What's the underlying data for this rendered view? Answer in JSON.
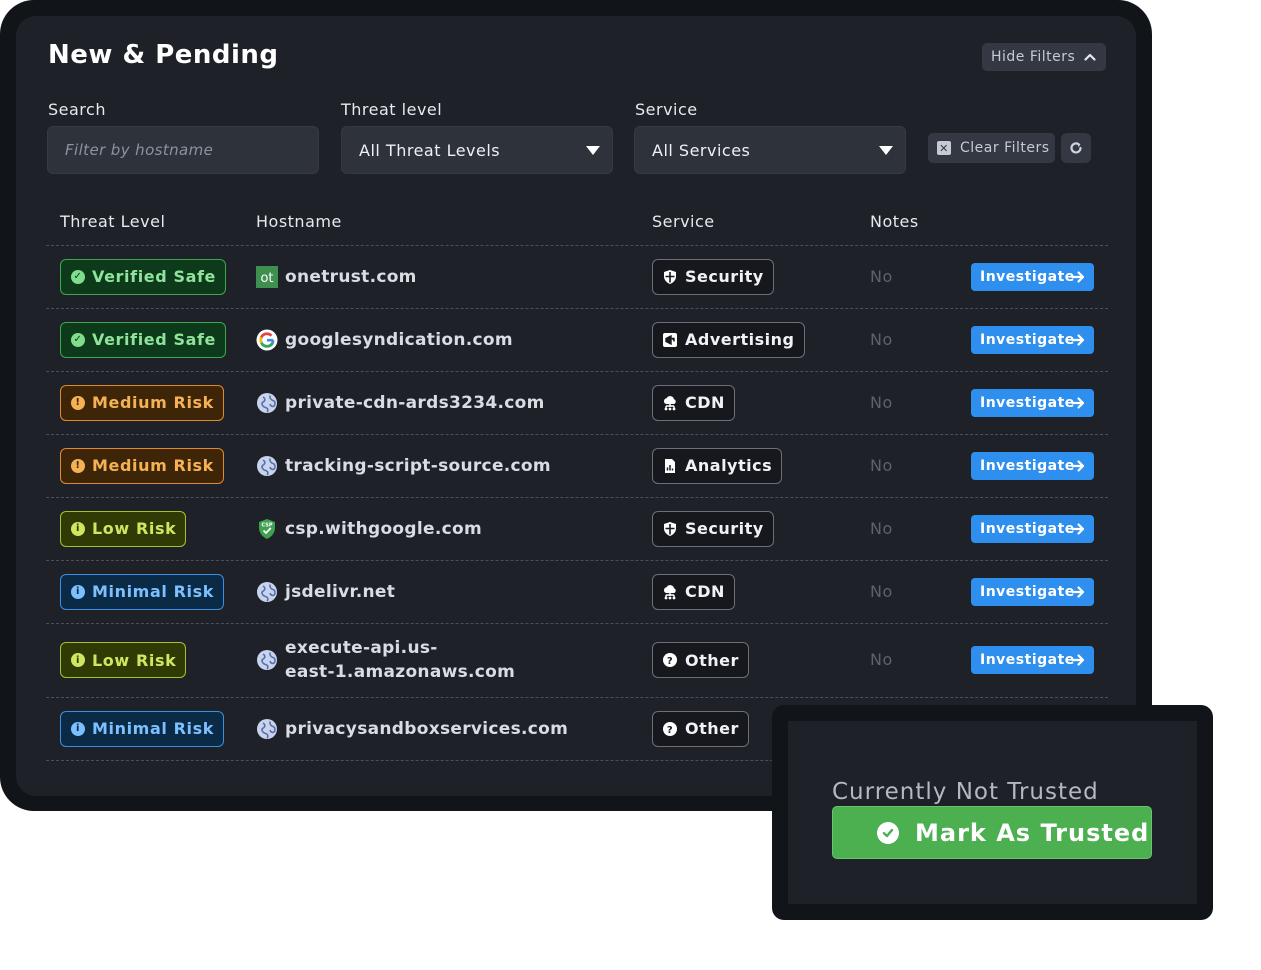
{
  "header": {
    "title": "New & Pending",
    "hide_filters_label": "Hide Filters"
  },
  "filters": {
    "search_label": "Search",
    "search_placeholder": "Filter by hostname",
    "threat_label": "Threat level",
    "threat_value": "All Threat Levels",
    "service_label": "Service",
    "service_value": "All Services",
    "clear_label": "Clear Filters"
  },
  "table": {
    "columns": [
      "Threat Level",
      "Hostname",
      "Service",
      "Notes"
    ],
    "rows": [
      {
        "threat": "Verified Safe",
        "threat_style": "green",
        "threat_icon": "check",
        "favicon": "onetrust-logo",
        "favicon_text": "ot",
        "host_lines": [
          "onetrust.com"
        ],
        "service": "Security",
        "service_icon": "shield-icon",
        "notes": "No",
        "action": "Investigate"
      },
      {
        "threat": "Verified Safe",
        "threat_style": "green",
        "threat_icon": "check",
        "favicon": "google-logo",
        "favicon_text": "",
        "host_lines": [
          "googlesyndication.com"
        ],
        "service": "Advertising",
        "service_icon": "megaphone-icon",
        "notes": "No",
        "action": "Investigate"
      },
      {
        "threat": "Medium Risk",
        "threat_style": "orange",
        "threat_icon": "!",
        "favicon": "globe",
        "favicon_text": "",
        "host_lines": [
          "private-cdn-ards3234.com"
        ],
        "service": "CDN",
        "service_icon": "cloud-network-icon",
        "notes": "No",
        "action": "Investigate"
      },
      {
        "threat": "Medium Risk",
        "threat_style": "orange",
        "threat_icon": "!",
        "favicon": "globe",
        "favicon_text": "",
        "host_lines": [
          "tracking-script-source.com"
        ],
        "service": "Analytics",
        "service_icon": "report-icon",
        "notes": "No",
        "action": "Investigate"
      },
      {
        "threat": "Low Risk",
        "threat_style": "lime",
        "threat_icon": "i",
        "favicon": "csp-shield",
        "favicon_text": "CSP",
        "host_lines": [
          "csp.withgoogle.com"
        ],
        "service": "Security",
        "service_icon": "shield-icon",
        "notes": "No",
        "action": "Investigate"
      },
      {
        "threat": "Minimal Risk",
        "threat_style": "blue",
        "threat_icon": "i",
        "favicon": "globe",
        "favicon_text": "",
        "host_lines": [
          "jsdelivr.net"
        ],
        "service": "CDN",
        "service_icon": "cloud-network-icon",
        "notes": "No",
        "action": "Investigate"
      },
      {
        "threat": "Low Risk",
        "threat_style": "lime",
        "threat_icon": "i",
        "favicon": "globe",
        "favicon_text": "",
        "host_lines": [
          "execute-api.us-",
          "east-1.amazonaws.com"
        ],
        "service": "Other",
        "service_icon": "question-icon",
        "notes": "No",
        "action": "Investigate"
      },
      {
        "threat": "Minimal Risk",
        "threat_style": "blue",
        "threat_icon": "i",
        "favicon": "globe",
        "favicon_text": "",
        "host_lines": [
          "privacysandboxservices.com"
        ],
        "service": "Other",
        "service_icon": "question-icon",
        "notes": "",
        "action": ""
      }
    ]
  },
  "popup": {
    "status": "Currently Not Trusted",
    "button": "Mark As Trusted"
  }
}
